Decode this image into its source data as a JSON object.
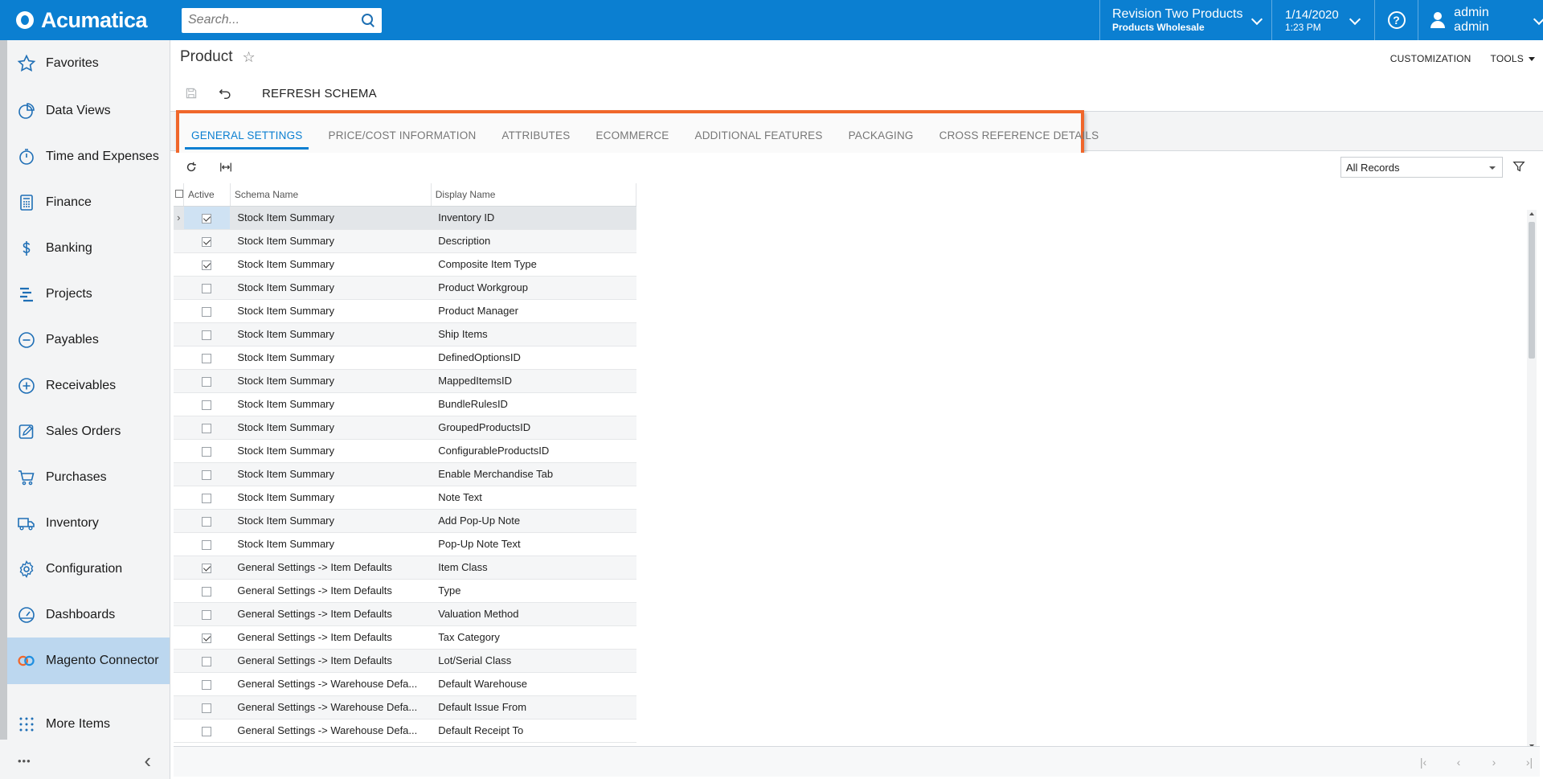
{
  "app": {
    "logo_text": "Acumatica",
    "accent_color": "#0b7fd1",
    "highlight_color": "#f0672b"
  },
  "topbar": {
    "search_placeholder": "Search...",
    "company_line1": "Revision Two Products",
    "company_line2": "Products Wholesale",
    "date": "1/14/2020",
    "time": "1:23 PM",
    "help_glyph": "?",
    "user_name": "admin admin"
  },
  "sidebar": {
    "items": [
      {
        "label": "Favorites",
        "icon": "star-icon"
      },
      {
        "label": "Data Views",
        "icon": "pie-chart-icon"
      },
      {
        "label": "Time and Expenses",
        "icon": "stopwatch-icon"
      },
      {
        "label": "Finance",
        "icon": "calculator-icon"
      },
      {
        "label": "Banking",
        "icon": "dollar-icon"
      },
      {
        "label": "Projects",
        "icon": "gantt-icon"
      },
      {
        "label": "Payables",
        "icon": "minus-circle-icon"
      },
      {
        "label": "Receivables",
        "icon": "plus-circle-icon"
      },
      {
        "label": "Sales Orders",
        "icon": "edit-icon"
      },
      {
        "label": "Purchases",
        "icon": "cart-icon"
      },
      {
        "label": "Inventory",
        "icon": "truck-icon"
      },
      {
        "label": "Configuration",
        "icon": "gear-icon"
      },
      {
        "label": "Dashboards",
        "icon": "gauge-icon"
      },
      {
        "label": "Magento Connector",
        "icon": "magento-connector-icon"
      },
      {
        "label": "More Items",
        "icon": "grid-dots-icon"
      }
    ],
    "active_item": "Magento Connector",
    "more_glyph": "•••",
    "collapse_glyph": "‹"
  },
  "page": {
    "title": "Product",
    "star_glyph": "☆",
    "customization_label": "CUSTOMIZATION",
    "tools_label": "TOOLS",
    "refresh_schema_label": "REFRESH SCHEMA"
  },
  "tabs": [
    {
      "label": "GENERAL SETTINGS",
      "active": true
    },
    {
      "label": "PRICE/COST INFORMATION",
      "active": false
    },
    {
      "label": "ATTRIBUTES",
      "active": false
    },
    {
      "label": "ECOMMERCE",
      "active": false
    },
    {
      "label": "ADDITIONAL FEATURES",
      "active": false
    },
    {
      "label": "PACKAGING",
      "active": false
    },
    {
      "label": "CROSS REFERENCE DETAILS",
      "active": false
    }
  ],
  "grid": {
    "filter_value": "All Records",
    "columns": {
      "active": "Active",
      "schema_name": "Schema Name",
      "display_name": "Display Name"
    },
    "rows": [
      {
        "active": true,
        "schema": "Stock Item Summary",
        "display": "Inventory ID"
      },
      {
        "active": true,
        "schema": "Stock Item Summary",
        "display": "Description"
      },
      {
        "active": true,
        "schema": "Stock Item Summary",
        "display": "Composite Item Type"
      },
      {
        "active": false,
        "schema": "Stock Item Summary",
        "display": "Product Workgroup"
      },
      {
        "active": false,
        "schema": "Stock Item Summary",
        "display": "Product Manager"
      },
      {
        "active": false,
        "schema": "Stock Item Summary",
        "display": "Ship Items"
      },
      {
        "active": false,
        "schema": "Stock Item Summary",
        "display": "DefinedOptionsID"
      },
      {
        "active": false,
        "schema": "Stock Item Summary",
        "display": "MappedItemsID"
      },
      {
        "active": false,
        "schema": "Stock Item Summary",
        "display": "BundleRulesID"
      },
      {
        "active": false,
        "schema": "Stock Item Summary",
        "display": "GroupedProductsID"
      },
      {
        "active": false,
        "schema": "Stock Item Summary",
        "display": "ConfigurableProductsID"
      },
      {
        "active": false,
        "schema": "Stock Item Summary",
        "display": "Enable Merchandise Tab"
      },
      {
        "active": false,
        "schema": "Stock Item Summary",
        "display": "Note Text"
      },
      {
        "active": false,
        "schema": "Stock Item Summary",
        "display": "Add Pop-Up Note"
      },
      {
        "active": false,
        "schema": "Stock Item Summary",
        "display": "Pop-Up Note Text"
      },
      {
        "active": true,
        "schema": "General Settings -> Item Defaults",
        "display": "Item Class"
      },
      {
        "active": false,
        "schema": "General Settings -> Item Defaults",
        "display": "Type"
      },
      {
        "active": false,
        "schema": "General Settings -> Item Defaults",
        "display": "Valuation Method"
      },
      {
        "active": true,
        "schema": "General Settings -> Item Defaults",
        "display": "Tax Category"
      },
      {
        "active": false,
        "schema": "General Settings -> Item Defaults",
        "display": "Lot/Serial Class"
      },
      {
        "active": false,
        "schema": "General Settings -> Warehouse Defa...",
        "display": "Default Warehouse"
      },
      {
        "active": false,
        "schema": "General Settings -> Warehouse Defa...",
        "display": "Default Issue From"
      },
      {
        "active": false,
        "schema": "General Settings -> Warehouse Defa...",
        "display": "Default Receipt To"
      }
    ]
  },
  "pager": {
    "first": "|‹",
    "prev": "‹",
    "next": "›",
    "last": "›|"
  }
}
